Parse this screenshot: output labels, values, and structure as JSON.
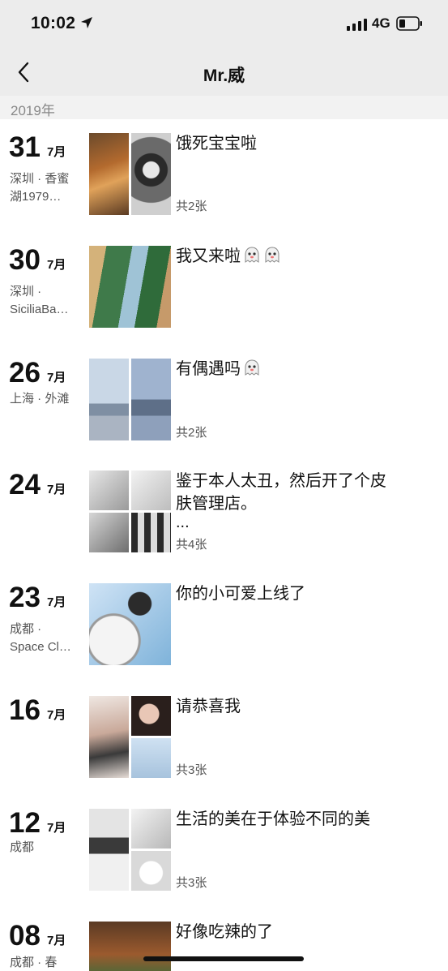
{
  "status_bar": {
    "time": "10:02",
    "network": "4G",
    "icons": [
      "location-arrow-icon",
      "signal-icon",
      "battery-icon"
    ]
  },
  "nav": {
    "title": "Mr.威",
    "back_icon": "chevron-left-icon"
  },
  "year": "2019年",
  "posts": [
    {
      "day": "31",
      "month": "7月",
      "location_lines": [
        "深圳 · 香蜜",
        "湖1979…"
      ],
      "caption": "饿死宝宝啦",
      "count": "共2张",
      "photos": 2
    },
    {
      "day": "30",
      "month": "7月",
      "location_lines": [
        "深圳 ·",
        "SiciliaBa…"
      ],
      "caption": "我又来啦",
      "emoji": [
        "ghost-icon",
        "ghost-icon"
      ],
      "count": "",
      "photos": 1
    },
    {
      "day": "26",
      "month": "7月",
      "location_lines": [
        "上海 · 外滩"
      ],
      "caption": "有偶遇吗",
      "emoji": [
        "ghost-icon"
      ],
      "count": "共2张",
      "photos": 2
    },
    {
      "day": "24",
      "month": "7月",
      "location_lines": [],
      "caption": "鉴于本人太丑，然后开了个皮",
      "caption2": "肤管理店。",
      "caption3": "...",
      "count": "共4张",
      "photos": 4
    },
    {
      "day": "23",
      "month": "7月",
      "location_lines": [
        "成都 ·",
        "Space Cl…"
      ],
      "caption": "你的小可爱上线了",
      "count": "",
      "photos": 1
    },
    {
      "day": "16",
      "month": "7月",
      "location_lines": [],
      "caption": "请恭喜我",
      "count": "共3张",
      "photos": 3
    },
    {
      "day": "12",
      "month": "7月",
      "location_lines": [
        "成都"
      ],
      "caption": "生活的美在于体验不同的美",
      "count": "共3张",
      "photos": 3
    },
    {
      "day": "08",
      "month": "7月",
      "location_lines": [
        "成都 · 春"
      ],
      "caption": "好像吃辣的了",
      "count": "",
      "photos": 1
    }
  ],
  "colors": {
    "header_bg": "#ececec",
    "year_bg": "#f2f2f2",
    "text": "#111111",
    "secondary": "#555555"
  }
}
